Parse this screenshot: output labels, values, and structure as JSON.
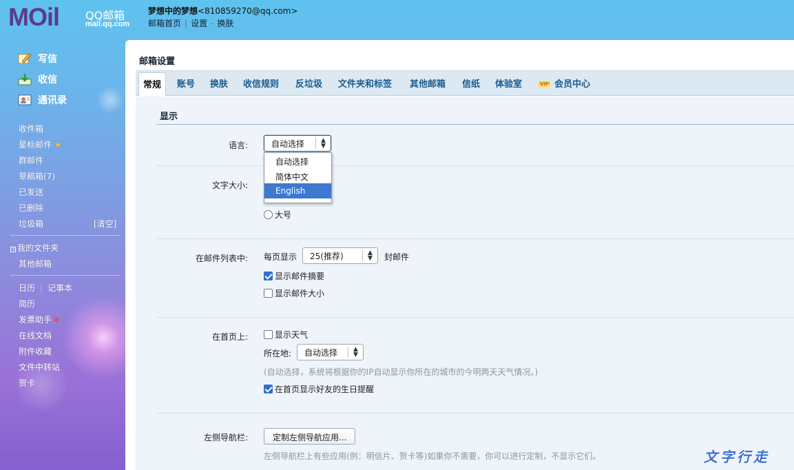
{
  "header": {
    "logo_text": "MOil",
    "logo_brand": "QQ邮箱",
    "logo_domain": "mail.qq.com",
    "user_name": "梦想中的梦想",
    "user_email": "<810859270@qq.com>",
    "links": [
      "邮箱首页",
      "设置",
      "换肤"
    ]
  },
  "sidebar": {
    "main_actions": [
      "写信",
      "收信",
      "通讯录"
    ],
    "folders": [
      "收件箱",
      "星标邮件",
      "群邮件",
      "草稿箱(7)",
      "已发送",
      "已删除",
      "垃圾箱"
    ],
    "trash_clear": "[清空]",
    "my_folders": "我的文件夹",
    "other_mailbox": "其他邮箱",
    "calendar": "日历",
    "notes": "记事本",
    "apps": [
      "简历",
      "发票助手",
      "在线文档",
      "附件收藏",
      "文件中转站",
      "贺卡"
    ]
  },
  "page": {
    "title": "邮箱设置",
    "tabs": [
      "常规",
      "账号",
      "换肤",
      "收信规则",
      "反垃圾",
      "文件夹和标签",
      "其他邮箱",
      "信纸",
      "体验室",
      "会员中心"
    ],
    "vip_badge": "VIP",
    "section_title": "显示"
  },
  "settings": {
    "language_label": "语言:",
    "language_value": "自动选择",
    "language_options": [
      "自动选择",
      "简体中文",
      "English"
    ],
    "font_size_label": "文字大小:",
    "font_size_large": "大号",
    "list_label": "在邮件列表中:",
    "per_page_prefix": "每页显示",
    "per_page_value": "25(推荐)",
    "per_page_suffix": "封邮件",
    "show_summary": "显示邮件摘要",
    "show_size": "显示邮件大小",
    "homepage_label": "在首页上:",
    "show_weather": "显示天气",
    "location_label": "所在地:",
    "location_value": "自动选择",
    "location_hint": "(自动选择，系统将根据你的IP自动显示你所在的城市的今明两天天气情况。)",
    "show_birthday": "在首页显示好友的生日提醒",
    "nav_label": "左侧导航栏:",
    "nav_button": "定制左侧导航应用...",
    "nav_hint": "左侧导航栏上有些应用(例：明信片、贺卡等)如果你不需要，你可以进行定制，不显示它们。"
  },
  "watermark": "文字行走",
  "colors": {
    "accent": "#3d79d0",
    "tab_text": "#1a5a8e",
    "logo": "#5a3b8a"
  }
}
